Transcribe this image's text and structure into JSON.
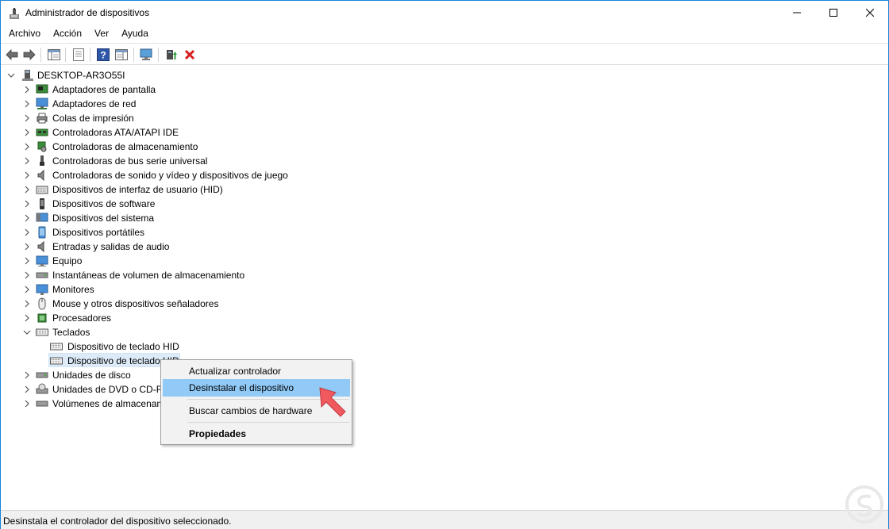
{
  "window": {
    "title": "Administrador de dispositivos",
    "controls": {
      "minimize": "—",
      "maximize": "☐",
      "close": "✕"
    }
  },
  "menu": [
    "Archivo",
    "Acción",
    "Ver",
    "Ayuda"
  ],
  "toolbar": {
    "icons": [
      "back-icon",
      "forward-icon",
      "show-hide-tree-icon",
      "properties-icon",
      "help-icon",
      "view-icon",
      "scan-hardware-icon",
      "update-driver-icon",
      "uninstall-icon"
    ]
  },
  "tree": {
    "root": "DESKTOP-AR3O55I",
    "categories": [
      {
        "label": "Adaptadores de pantalla",
        "icon": "display-adapter-icon"
      },
      {
        "label": "Adaptadores de red",
        "icon": "network-adapter-icon"
      },
      {
        "label": "Colas de impresión",
        "icon": "print-queue-icon"
      },
      {
        "label": "Controladoras ATA/ATAPI IDE",
        "icon": "ide-controller-icon"
      },
      {
        "label": "Controladoras de almacenamiento",
        "icon": "storage-controller-icon"
      },
      {
        "label": "Controladoras de bus serie universal",
        "icon": "usb-icon"
      },
      {
        "label": "Controladoras de sonido y vídeo y dispositivos de juego",
        "icon": "sound-icon"
      },
      {
        "label": "Dispositivos de interfaz de usuario (HID)",
        "icon": "hid-icon"
      },
      {
        "label": "Dispositivos de software",
        "icon": "software-device-icon"
      },
      {
        "label": "Dispositivos del sistema",
        "icon": "system-device-icon"
      },
      {
        "label": "Dispositivos portátiles",
        "icon": "portable-device-icon"
      },
      {
        "label": "Entradas y salidas de audio",
        "icon": "audio-io-icon"
      },
      {
        "label": "Equipo",
        "icon": "computer-icon"
      },
      {
        "label": "Instantáneas de volumen de almacenamiento",
        "icon": "volume-snapshot-icon"
      },
      {
        "label": "Monitores",
        "icon": "monitor-icon"
      },
      {
        "label": "Mouse y otros dispositivos señaladores",
        "icon": "mouse-icon"
      },
      {
        "label": "Procesadores",
        "icon": "processor-icon"
      },
      {
        "label": "Teclados",
        "icon": "keyboard-icon",
        "expanded": true,
        "children": [
          "Dispositivo de teclado HID",
          "Dispositivo de teclado HID"
        ]
      },
      {
        "label": "Unidades de disco",
        "icon": "disk-drive-icon"
      },
      {
        "label": "Unidades de DVD o CD-ROM",
        "icon": "dvd-icon"
      },
      {
        "label": "Volúmenes de almacenamiento",
        "icon": "storage-volume-icon"
      }
    ]
  },
  "context_menu": {
    "items": [
      {
        "label": "Actualizar controlador",
        "highlighted": false,
        "bold": false
      },
      {
        "label": "Desinstalar el dispositivo",
        "highlighted": true,
        "bold": false
      },
      {
        "label": "Buscar cambios de hardware",
        "highlighted": false,
        "bold": false
      },
      {
        "label": "Propiedades",
        "highlighted": false,
        "bold": true
      }
    ]
  },
  "status": "Desinstala el controlador del dispositivo seleccionado.",
  "colors": {
    "accent": "#1883d7",
    "selection": "#dcebf7",
    "menu_highlight": "#91c9f7",
    "pointer_arrow": "#f05a5f",
    "uninstall_red": "#d81e1e"
  }
}
